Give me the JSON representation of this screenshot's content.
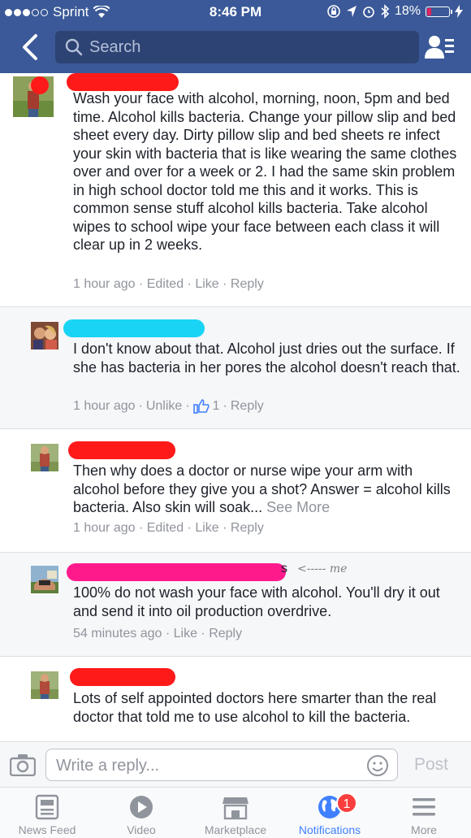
{
  "status": {
    "carrier": "Sprint",
    "time": "8:46 PM",
    "battery_text": "18%",
    "battery_level": 0.18
  },
  "nav": {
    "search_placeholder": "Search"
  },
  "comments": [
    {
      "text": "Wash your face with alcohol, morning, noon, 5pm and bed time. Alcohol kills bacteria.  Change your pillow slip and bed sheet every day.  Dirty pillow slip and bed sheets re infect your skin with bacteria that is like wearing the same clothes over and over for a week or 2.  I had the same skin problem in high school doctor told me this and it works.  This is common sense stuff alcohol kills bacteria.  Take alcohol wipes to school wipe your face between each class it will clear up in 2 weeks.",
      "time": "1 hour ago",
      "edited": "Edited",
      "action": "Like",
      "reply": "Reply",
      "name_redaction_color": "#ff1a1a"
    },
    {
      "text": "I don't know about that.   Alcohol just dries out the surface.  If she has bacteria in her pores the alcohol doesn't reach that.",
      "time": "1 hour ago",
      "action": "Unlike",
      "like_count": "1",
      "reply": "Reply",
      "name_redaction_color": "#1ad4f5"
    },
    {
      "text": "Then why does a doctor or nurse wipe your arm with alcohol before they give you a shot?  Answer = alcohol kills bacteria.  Also skin will soak...",
      "see_more": "See More",
      "time": "1 hour ago",
      "edited": "Edited",
      "action": "Like",
      "reply": "Reply",
      "name_redaction_color": "#ff1a1a"
    },
    {
      "name_suffix": "s",
      "annotation": "<----- me",
      "text": "100% do not wash your face with alcohol. You'll dry it out and send it into oil production overdrive.",
      "time": "54 minutes ago",
      "action": "Like",
      "reply": "Reply",
      "name_redaction_color": "#ff1a8c"
    },
    {
      "text": "Lots of self appointed doctors here smarter than the real doctor that told me to use alcohol to kill the bacteria.",
      "name_redaction_color": "#ff1a1a"
    }
  ],
  "reply_bar": {
    "placeholder": "Write a reply...",
    "post_label": "Post"
  },
  "tabs": [
    {
      "label": "News Feed",
      "icon": "news-feed-icon"
    },
    {
      "label": "Video",
      "icon": "video-icon"
    },
    {
      "label": "Marketplace",
      "icon": "marketplace-icon"
    },
    {
      "label": "Notifications",
      "icon": "globe-icon",
      "badge": "1",
      "active": true
    },
    {
      "label": "More",
      "icon": "menu-icon"
    }
  ],
  "colors": {
    "header": "#3b5998",
    "link_active": "#4080ff",
    "meta_gray": "#90949c"
  }
}
